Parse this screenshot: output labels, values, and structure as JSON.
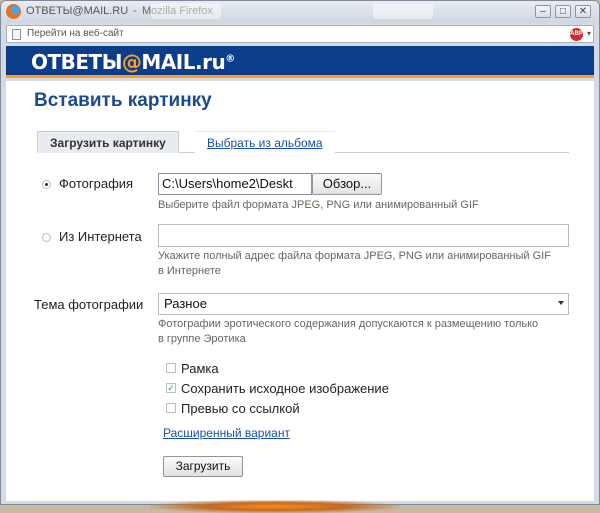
{
  "window": {
    "title_site": "ОТВЕТЫ@MAIL.RU",
    "title_separator": "-",
    "title_app": "Mozilla Firefox",
    "minimize": "–",
    "maximize": "□",
    "close": "✕"
  },
  "addressbar": {
    "placeholder": "Перейти на веб-сайт",
    "adblock_label": "ABP"
  },
  "brand": {
    "name_left": "ОТВЕТЫ",
    "at": "@",
    "name_right": "MAIL.ru",
    "reg": "®",
    "primary_color": "#0b3d8c",
    "accent_color": "#ff9e1b"
  },
  "page": {
    "title": "Вставить картинку"
  },
  "tabs": [
    {
      "label": "Загрузить картинку",
      "active": true
    },
    {
      "label": "Выбрать из альбома",
      "active": false
    }
  ],
  "form": {
    "photo": {
      "label": "Фотография",
      "selected": true,
      "file_value": "C:\\Users\\home2\\Deskt",
      "browse_label": "Обзор...",
      "hint": "Выберите файл формата JPEG, PNG или анимированный GIF"
    },
    "internet": {
      "label": "Из Интернета",
      "selected": false,
      "url_value": "",
      "hint_line1": "Укажите полный адрес файла формата JPEG, PNG или анимированный GIF",
      "hint_line2": "в Интернете"
    },
    "topic": {
      "label": "Тема фотографии",
      "selected_value": "Разное",
      "hint_line1": "Фотографии эротического содержания допускаются к размещению только",
      "hint_line2": "в группе Эротика"
    },
    "checkboxes": [
      {
        "label": "Рамка",
        "checked": false
      },
      {
        "label": "Сохранить исходное изображение",
        "checked": true
      },
      {
        "label": "Превью со ссылкой",
        "checked": false
      }
    ],
    "advanced_link": "Расширенный вариант",
    "submit_label": "Загрузить"
  }
}
